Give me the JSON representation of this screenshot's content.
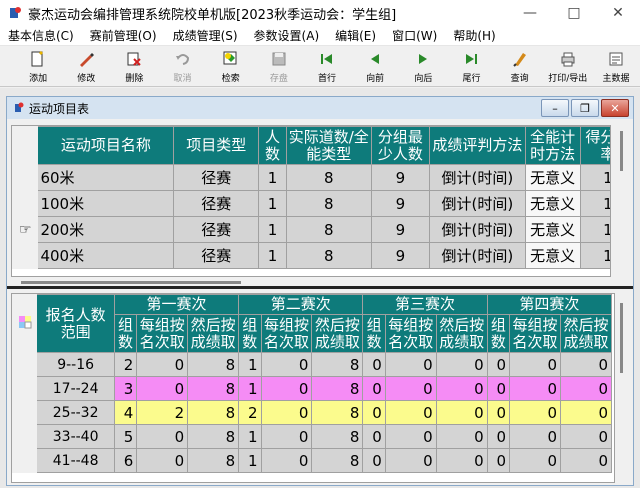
{
  "window": {
    "title": "豪杰运动会编排管理系统院校单机版[2023秋季运动会：学生组]"
  },
  "menu": [
    "基本信息(C)",
    "赛前管理(O)",
    "成绩管理(S)",
    "参数设置(A)",
    "编辑(E)",
    "窗口(W)",
    "帮助(H)"
  ],
  "toolbar": {
    "buttons": [
      {
        "label": "添加",
        "icon": "add-doc-icon",
        "enabled": true
      },
      {
        "label": "修改",
        "icon": "edit-pen-icon",
        "enabled": true
      },
      {
        "label": "删除",
        "icon": "delete-icon",
        "enabled": true
      },
      {
        "label": "取消",
        "icon": "undo-icon",
        "enabled": false
      },
      {
        "label": "检索",
        "icon": "search-icon",
        "enabled": true
      },
      {
        "label": "存盘",
        "icon": "save-disk-icon",
        "enabled": false
      },
      {
        "label": "首行",
        "icon": "first-record-icon",
        "enabled": true
      },
      {
        "label": "向前",
        "icon": "prev-record-icon",
        "enabled": true
      },
      {
        "label": "向后",
        "icon": "next-record-icon",
        "enabled": true
      },
      {
        "label": "尾行",
        "icon": "last-record-icon",
        "enabled": true
      },
      {
        "label": "查询",
        "icon": "query-icon",
        "enabled": true
      },
      {
        "label": "打印/导出",
        "icon": "print-icon",
        "enabled": true
      },
      {
        "label": "主数据",
        "icon": "master-data-icon",
        "enabled": true
      }
    ]
  },
  "child_window": {
    "title": "运动项目表"
  },
  "events_table": {
    "headers": [
      "运动项目名称",
      "项目类型",
      "人数",
      "实际道数/全能类型",
      "分组最少人数",
      "成绩评判方法",
      "全能计时方法",
      "得分倍率"
    ],
    "rows": [
      {
        "name": "60米",
        "type": "径赛",
        "count": "1",
        "lanes": "8",
        "min": "9",
        "method": "倒计(时间)",
        "timing": "无意义",
        "rate": "1"
      },
      {
        "name": "100米",
        "type": "径赛",
        "count": "1",
        "lanes": "8",
        "min": "9",
        "method": "倒计(时间)",
        "timing": "无意义",
        "rate": "1"
      },
      {
        "name": "200米",
        "type": "径赛",
        "count": "1",
        "lanes": "8",
        "min": "9",
        "method": "倒计(时间)",
        "timing": "无意义",
        "rate": "1"
      },
      {
        "name": "400米",
        "type": "径赛",
        "count": "1",
        "lanes": "8",
        "min": "9",
        "method": "倒计(时间)",
        "timing": "无意义",
        "rate": "1"
      }
    ]
  },
  "rounds_table": {
    "range_header": "报名人数范围",
    "rounds": [
      "第一赛次",
      "第二赛次",
      "第三赛次",
      "第四赛次"
    ],
    "sub_headers": [
      "组数",
      "每组按名次取",
      "然后按成绩取"
    ],
    "rows": [
      {
        "range": "9--16",
        "color": "grey",
        "vals": [
          "2",
          "0",
          "8",
          "1",
          "0",
          "8",
          "0",
          "0",
          "0",
          "0",
          "0",
          "0"
        ]
      },
      {
        "range": "17--24",
        "color": "pink",
        "vals": [
          "3",
          "0",
          "8",
          "1",
          "0",
          "8",
          "0",
          "0",
          "0",
          "0",
          "0",
          "0"
        ]
      },
      {
        "range": "25--32",
        "color": "yellow",
        "vals": [
          "4",
          "2",
          "8",
          "2",
          "0",
          "8",
          "0",
          "0",
          "0",
          "0",
          "0",
          "0"
        ]
      },
      {
        "range": "33--40",
        "color": "grey",
        "vals": [
          "5",
          "0",
          "8",
          "1",
          "0",
          "8",
          "0",
          "0",
          "0",
          "0",
          "0",
          "0"
        ]
      },
      {
        "range": "41--48",
        "color": "grey",
        "vals": [
          "6",
          "0",
          "8",
          "1",
          "0",
          "8",
          "0",
          "0",
          "0",
          "0",
          "0",
          "0"
        ]
      }
    ]
  }
}
